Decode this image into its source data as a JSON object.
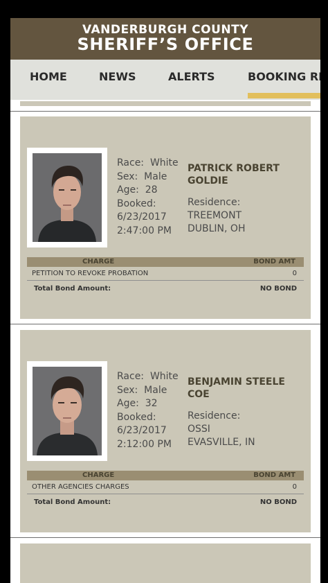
{
  "header": {
    "line1": "VANDERBURGH COUNTY",
    "line2": "SHERIFF’S OFFICE"
  },
  "nav": {
    "items": [
      "HOME",
      "NEWS",
      "ALERTS",
      "BOOKING REC"
    ],
    "active_index": 3
  },
  "bookings": [
    {
      "race_label": "Race:",
      "race": "White",
      "sex_label": "Sex:",
      "sex": "Male",
      "age_label": "Age:",
      "age": "28",
      "booked_label": "Booked:",
      "booked_date": "6/23/2017",
      "booked_time": "2:47:00 PM",
      "name_line1": "PATRICK ROBERT",
      "name_line2": "GOLDIE",
      "residence_label": "Residence:",
      "residence_line1": "TREEMONT",
      "residence_line2": "DUBLIN, OH",
      "charge_header": "CHARGE",
      "bond_header": "BOND AMT",
      "charge": "PETITION TO REVOKE PROBATION",
      "bond": "0",
      "total_label": "Total Bond Amount:",
      "total_value": "NO BOND"
    },
    {
      "race_label": "Race:",
      "race": "White",
      "sex_label": "Sex:",
      "sex": "Male",
      "age_label": "Age:",
      "age": "32",
      "booked_label": "Booked:",
      "booked_date": "6/23/2017",
      "booked_time": "2:12:00 PM",
      "name_line1": "BENJAMIN STEELE",
      "name_line2": "COE",
      "residence_label": "Residence:",
      "residence_line1": "OSSI",
      "residence_line2": "EVASVILLE, IN",
      "charge_header": "CHARGE",
      "bond_header": "BOND AMT",
      "charge": "OTHER AGENCIES CHARGES",
      "bond": "0",
      "total_label": "Total Bond Amount:",
      "total_value": "NO BOND"
    }
  ],
  "colors": {
    "header_bg": "#63553f",
    "nav_bg": "#e0e1dc",
    "nav_accent": "#e2bf5c",
    "card_bg": "#cbc7b7",
    "table_header_bg": "#9a8e72"
  }
}
